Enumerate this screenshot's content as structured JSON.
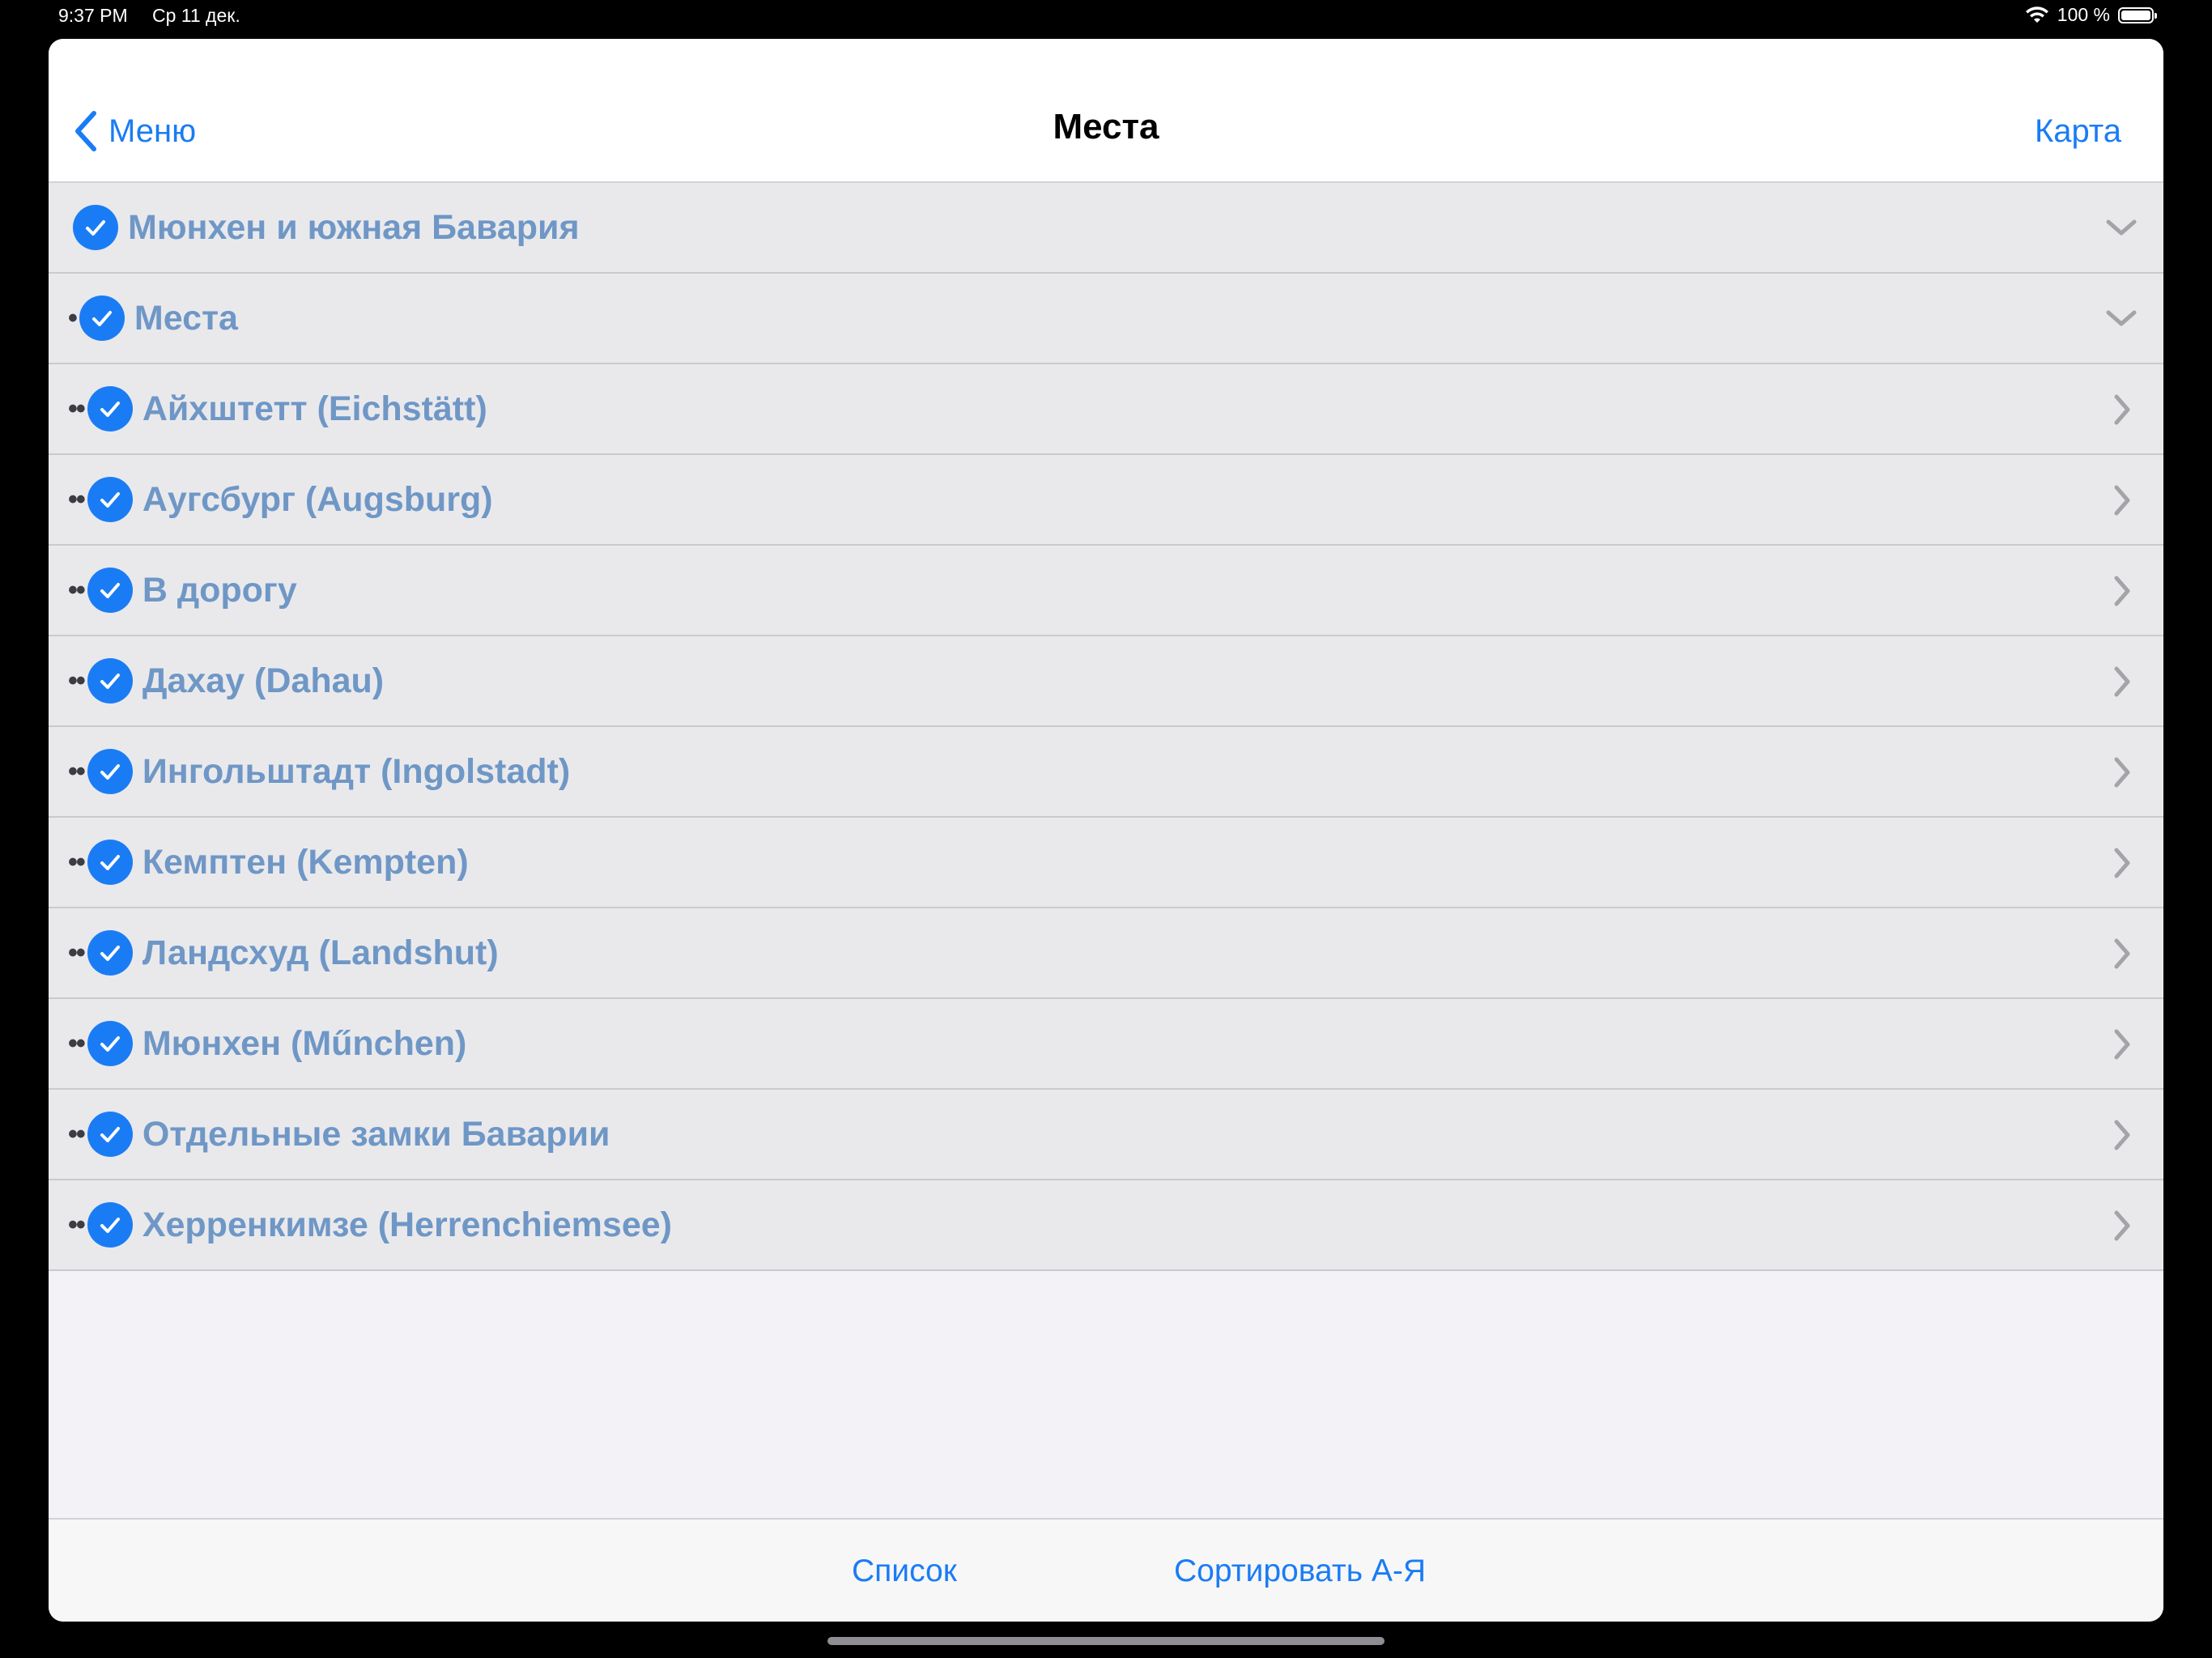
{
  "status_bar": {
    "time": "9:37 PM",
    "date": "Ср 11 дек.",
    "battery": "100 %"
  },
  "nav": {
    "back_label": "Меню",
    "title": "Места",
    "right_label": "Карта"
  },
  "list": {
    "items": [
      {
        "prefix": "",
        "label": "Мюнхен и южная Бавария",
        "disclosure": "chevron-down-icon"
      },
      {
        "prefix": "•",
        "label": "Места",
        "disclosure": "chevron-down-icon"
      },
      {
        "prefix": "••",
        "label": "Айхштетт (Eichstätt)",
        "disclosure": "chevron-right-icon"
      },
      {
        "prefix": "••",
        "label": "Аугсбург (Augsburg)",
        "disclosure": "chevron-right-icon"
      },
      {
        "prefix": "••",
        "label": "В дорогу",
        "disclosure": "chevron-right-icon"
      },
      {
        "prefix": "••",
        "label": "Дахау (Dahau)",
        "disclosure": "chevron-right-icon"
      },
      {
        "prefix": "••",
        "label": "Ингольштадт (Ingolstadt)",
        "disclosure": "chevron-right-icon"
      },
      {
        "prefix": "••",
        "label": "Кемптен (Kempten)",
        "disclosure": "chevron-right-icon"
      },
      {
        "prefix": "••",
        "label": "Ландсхуд (Landshut)",
        "disclosure": "chevron-right-icon"
      },
      {
        "prefix": "••",
        "label": "Мюнхен (Műnchen)",
        "disclosure": "chevron-right-icon"
      },
      {
        "prefix": "••",
        "label": "Отдельные замки Баварии",
        "disclosure": "chevron-right-icon"
      },
      {
        "prefix": "••",
        "label": "Херренкимзе (Herrenchiemsee)",
        "disclosure": "chevron-right-icon"
      }
    ]
  },
  "toolbar": {
    "list_label": "Список",
    "sort_label": "Сортировать А-Я"
  },
  "colors": {
    "accent": "#1a7cf5",
    "row_text": "#6f97c6",
    "row_bg": "#e9e9ec",
    "sheet_bg": "#f2f2f7"
  }
}
